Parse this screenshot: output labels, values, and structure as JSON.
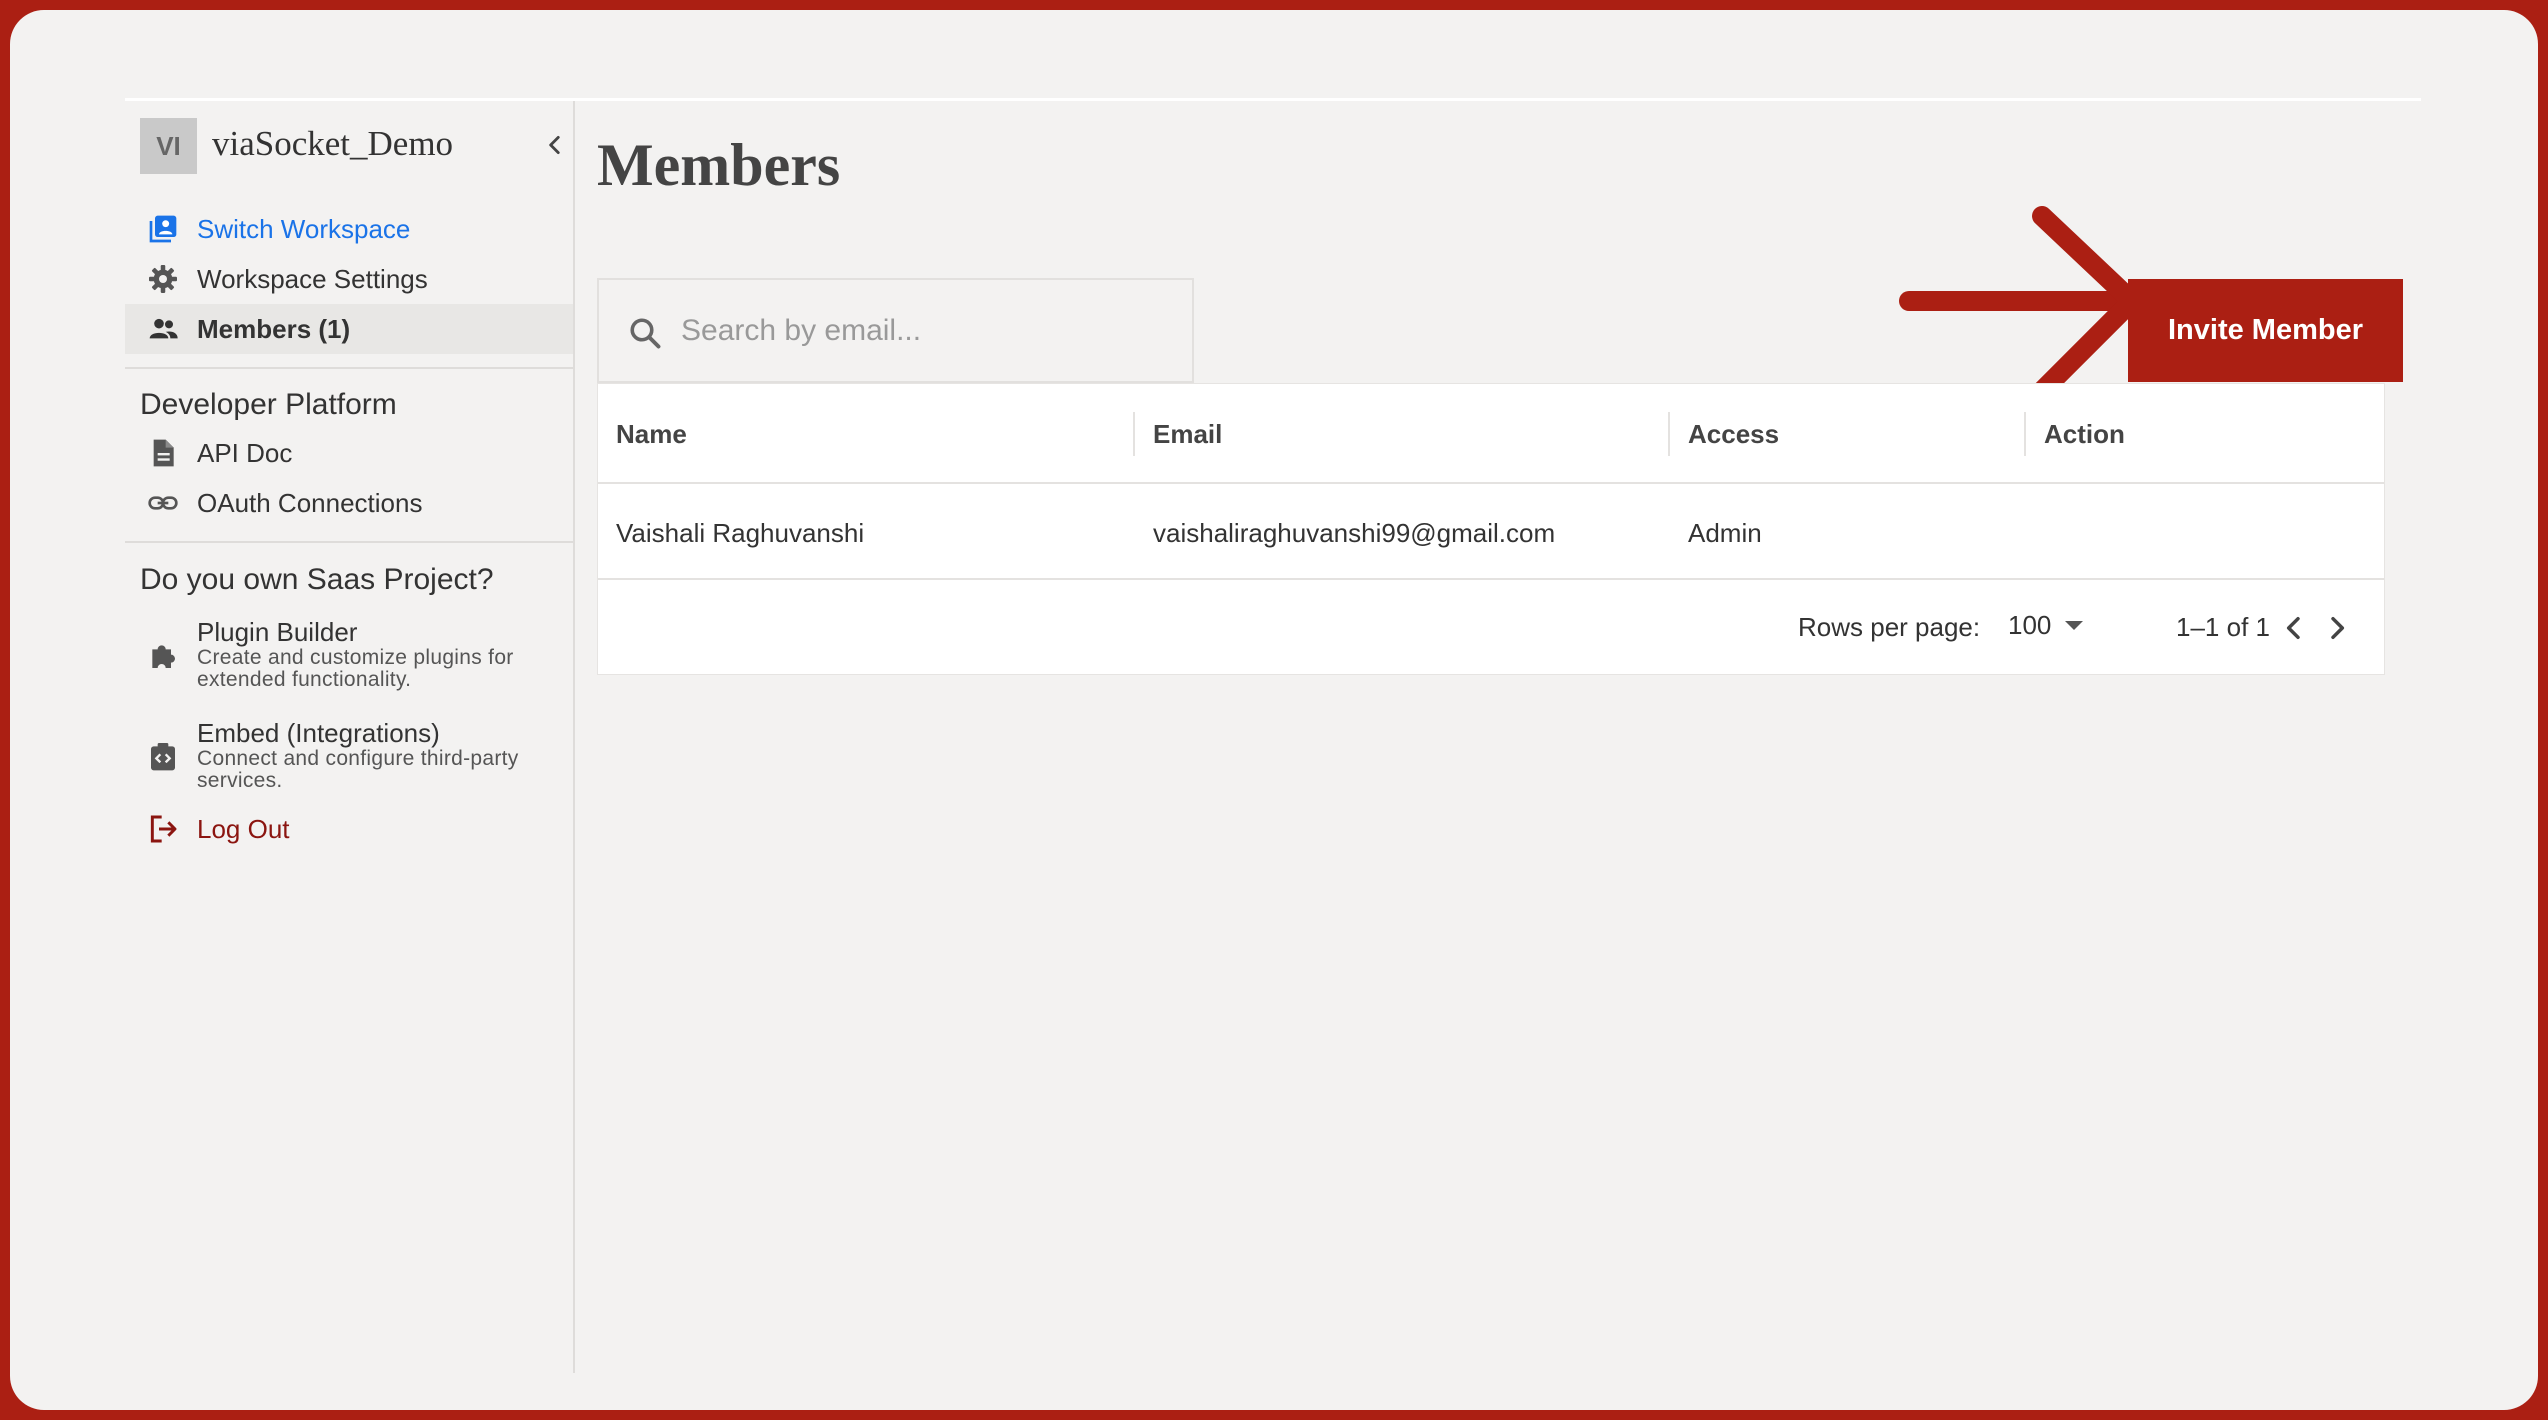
{
  "workspace": {
    "avatar_initials": "VI",
    "name": "viaSocket_Demo"
  },
  "sidebar": {
    "nav": [
      {
        "label": "Switch Workspace",
        "icon": "switch-workspace-icon"
      },
      {
        "label": "Workspace Settings",
        "icon": "gear-icon"
      },
      {
        "label": "Members (1)",
        "icon": "people-icon"
      }
    ],
    "developer_title": "Developer Platform",
    "developer_items": [
      {
        "label": "API Doc",
        "icon": "document-icon"
      },
      {
        "label": "OAuth Connections",
        "icon": "link-icon"
      }
    ],
    "saas_title": "Do you own Saas Project?",
    "saas_items": [
      {
        "title": "Plugin Builder",
        "desc": "Create and customize plugins for extended functionality.",
        "icon": "puzzle-icon"
      },
      {
        "title": "Embed (Integrations)",
        "desc": "Connect and configure third-party services.",
        "icon": "embed-icon"
      }
    ],
    "logout_label": "Log Out"
  },
  "main": {
    "title": "Members",
    "search_placeholder": "Search by email...",
    "invite_label": "Invite Member",
    "table": {
      "columns": [
        "Name",
        "Email",
        "Access",
        "Action"
      ],
      "rows": [
        {
          "name": "Vaishali Raghuvanshi",
          "email": "vaishaliraghuvanshi99@gmail.com",
          "access": "Admin",
          "action": ""
        }
      ],
      "footer": {
        "rows_per_page_label": "Rows per page:",
        "rows_per_page_value": "100",
        "range": "1–1 of 1"
      }
    }
  },
  "colors": {
    "brand_red": "#ab1f13",
    "link_blue": "#1a73e8",
    "logout_red": "#8b1510"
  }
}
